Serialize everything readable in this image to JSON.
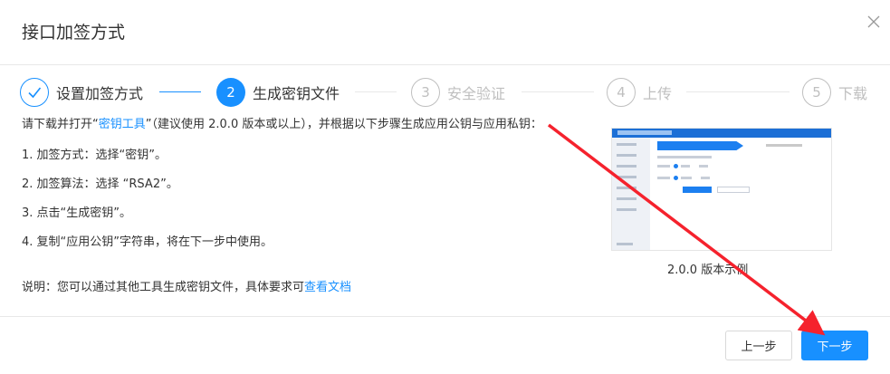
{
  "dialog": {
    "title": "接口加签方式",
    "close_icon": "close-icon"
  },
  "steps": [
    {
      "number": "✓",
      "label": "设置加签方式",
      "state": "done"
    },
    {
      "number": "2",
      "label": "生成密钥文件",
      "state": "active"
    },
    {
      "number": "3",
      "label": "安全验证",
      "state": "todo"
    },
    {
      "number": "4",
      "label": "上传",
      "state": "todo"
    },
    {
      "number": "5",
      "label": "下载",
      "state": "todo"
    }
  ],
  "instructions": {
    "intro_before": "请下载并打开“",
    "intro_link": "密钥工具",
    "intro_after": "”（建议使用 2.0.0 版本或以上），并根据以下步骤生成应用公钥与应用私钥：",
    "step1": "1. 加签方式：选择“密钥”。",
    "step2": "2. 加签算法：选择 “RSA2”。",
    "step3": "3. 点击“生成密钥”。",
    "step4": "4. 复制“应用公钥”字符串，将在下一步中使用。",
    "note_before": "说明：您可以通过其他工具生成密钥文件，具体要求可",
    "note_link": "查看文档"
  },
  "preview": {
    "caption": "2.0.0 版本示例"
  },
  "footer": {
    "prev_label": "上一步",
    "next_label": "下一步"
  },
  "colors": {
    "accent": "#1890ff",
    "annotation_arrow": "#f5222d"
  }
}
